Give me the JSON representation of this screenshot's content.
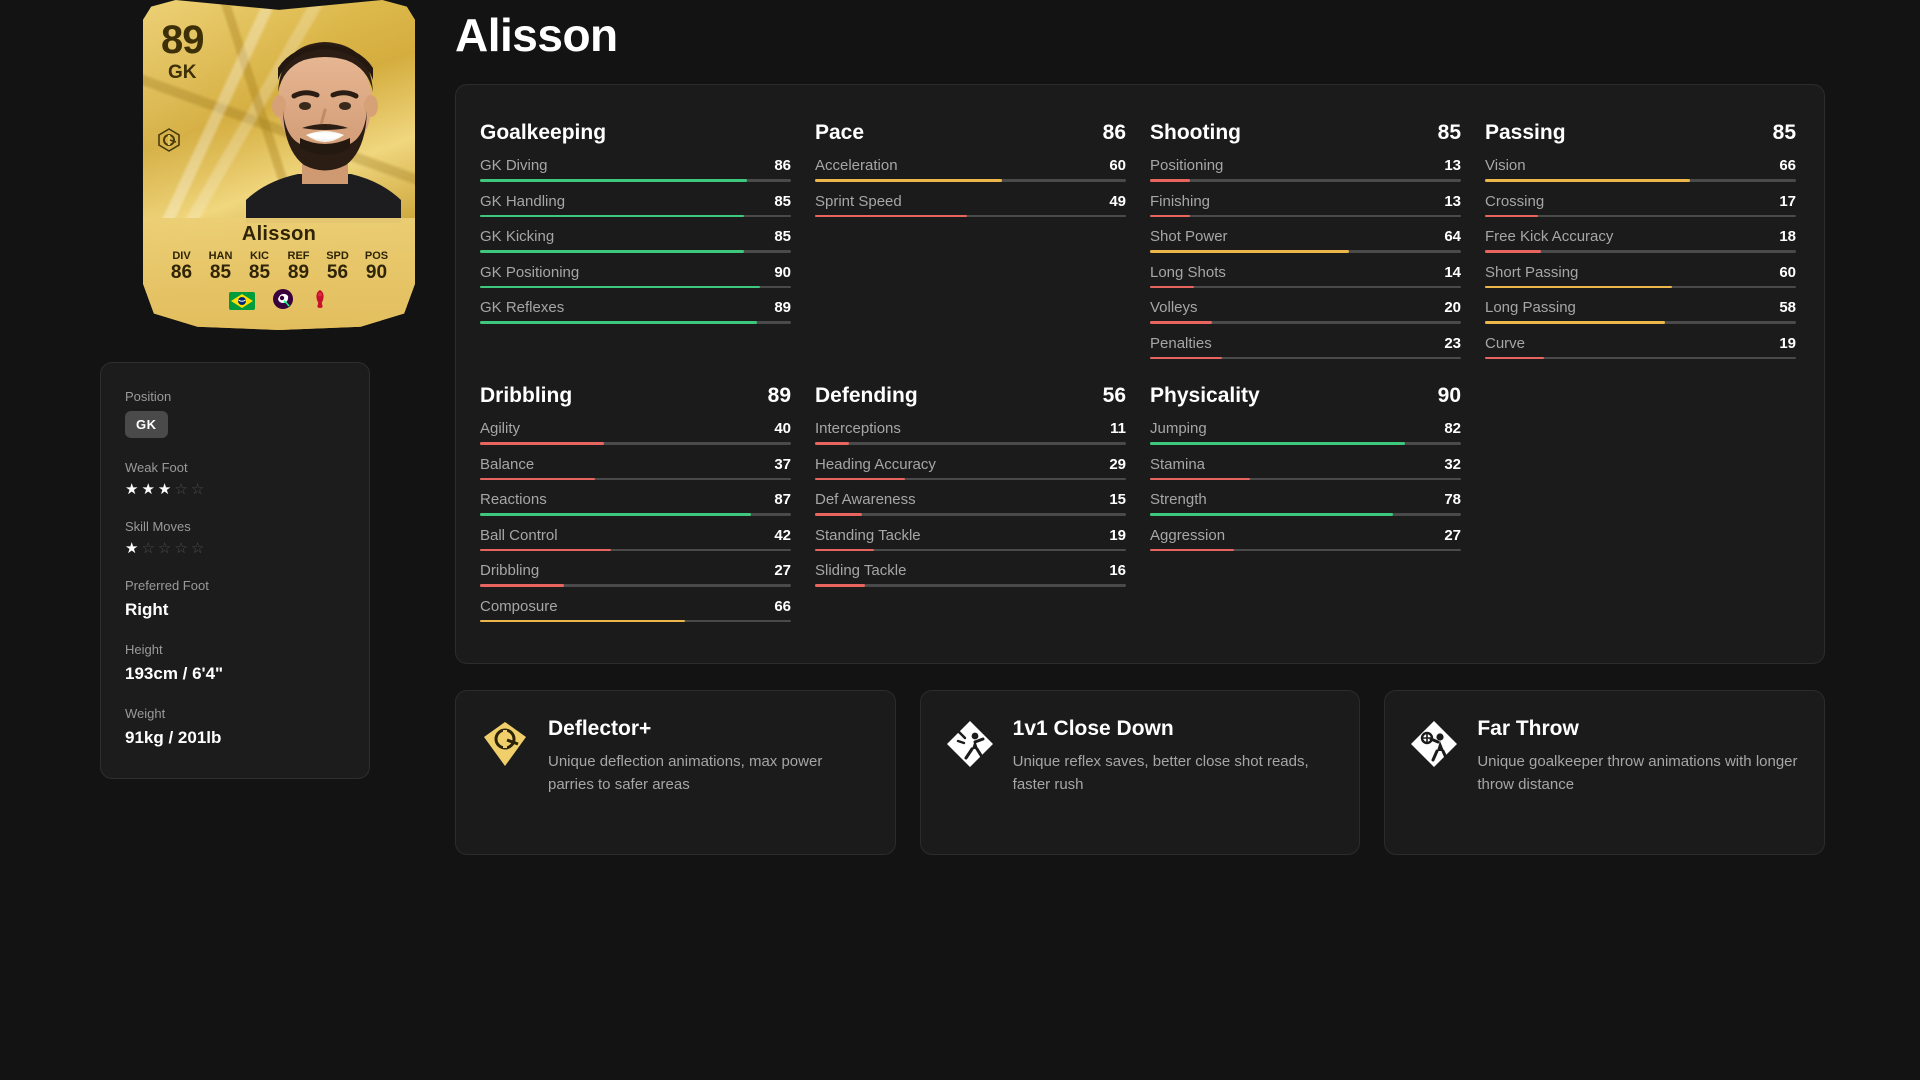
{
  "player": {
    "name": "Alisson",
    "card": {
      "rating": "89",
      "position": "GK",
      "name": "Alisson",
      "stats": [
        {
          "label": "DIV",
          "value": "86"
        },
        {
          "label": "HAN",
          "value": "85"
        },
        {
          "label": "KIC",
          "value": "85"
        },
        {
          "label": "REF",
          "value": "89"
        },
        {
          "label": "SPD",
          "value": "56"
        },
        {
          "label": "POS",
          "value": "90"
        }
      ],
      "nation": "Brazil",
      "league": "Premier League",
      "club": "Liverpool"
    }
  },
  "info": {
    "position_label": "Position",
    "position_value": "GK",
    "weak_foot_label": "Weak Foot",
    "weak_foot": 3,
    "skill_moves_label": "Skill Moves",
    "skill_moves": 1,
    "preferred_foot_label": "Preferred Foot",
    "preferred_foot_value": "Right",
    "height_label": "Height",
    "height_value": "193cm / 6'4\"",
    "weight_label": "Weight",
    "weight_value": "91kg / 201lb"
  },
  "colors": {
    "high": "#3ec87d",
    "mid": "#edb64a",
    "low": "#e8655f",
    "track": "#4a4a4a",
    "gold": "#f0cf6b"
  },
  "stat_groups": [
    {
      "name": "Goalkeeping",
      "total": "",
      "stats": [
        {
          "name": "GK Diving",
          "value": 86
        },
        {
          "name": "GK Handling",
          "value": 85
        },
        {
          "name": "GK Kicking",
          "value": 85
        },
        {
          "name": "GK Positioning",
          "value": 90
        },
        {
          "name": "GK Reflexes",
          "value": 89
        }
      ]
    },
    {
      "name": "Pace",
      "total": "86",
      "stats": [
        {
          "name": "Acceleration",
          "value": 60
        },
        {
          "name": "Sprint Speed",
          "value": 49
        }
      ]
    },
    {
      "name": "Shooting",
      "total": "85",
      "stats": [
        {
          "name": "Positioning",
          "value": 13
        },
        {
          "name": "Finishing",
          "value": 13
        },
        {
          "name": "Shot Power",
          "value": 64
        },
        {
          "name": "Long Shots",
          "value": 14
        },
        {
          "name": "Volleys",
          "value": 20
        },
        {
          "name": "Penalties",
          "value": 23
        }
      ]
    },
    {
      "name": "Passing",
      "total": "85",
      "stats": [
        {
          "name": "Vision",
          "value": 66
        },
        {
          "name": "Crossing",
          "value": 17
        },
        {
          "name": "Free Kick Accuracy",
          "value": 18
        },
        {
          "name": "Short Passing",
          "value": 60
        },
        {
          "name": "Long Passing",
          "value": 58
        },
        {
          "name": "Curve",
          "value": 19
        }
      ]
    },
    {
      "name": "Dribbling",
      "total": "89",
      "stats": [
        {
          "name": "Agility",
          "value": 40
        },
        {
          "name": "Balance",
          "value": 37
        },
        {
          "name": "Reactions",
          "value": 87
        },
        {
          "name": "Ball Control",
          "value": 42
        },
        {
          "name": "Dribbling",
          "value": 27
        },
        {
          "name": "Composure",
          "value": 66
        }
      ]
    },
    {
      "name": "Defending",
      "total": "56",
      "stats": [
        {
          "name": "Interceptions",
          "value": 11
        },
        {
          "name": "Heading Accuracy",
          "value": 29
        },
        {
          "name": "Def Awareness",
          "value": 15
        },
        {
          "name": "Standing Tackle",
          "value": 19
        },
        {
          "name": "Sliding Tackle",
          "value": 16
        }
      ]
    },
    {
      "name": "Physicality",
      "total": "90",
      "stats": [
        {
          "name": "Jumping",
          "value": 82
        },
        {
          "name": "Stamina",
          "value": 32
        },
        {
          "name": "Strength",
          "value": 78
        },
        {
          "name": "Aggression",
          "value": 27
        }
      ]
    }
  ],
  "playstyles": [
    {
      "name": "Deflector+",
      "desc": "Unique deflection animations, max power parries to safer areas",
      "plus": true,
      "icon": "deflector-icon"
    },
    {
      "name": "1v1 Close Down",
      "desc": "Unique reflex saves, better close shot reads, faster rush",
      "plus": false,
      "icon": "close-down-icon"
    },
    {
      "name": "Far Throw",
      "desc": "Unique goalkeeper throw animations with longer throw distance",
      "plus": false,
      "icon": "far-throw-icon"
    }
  ]
}
